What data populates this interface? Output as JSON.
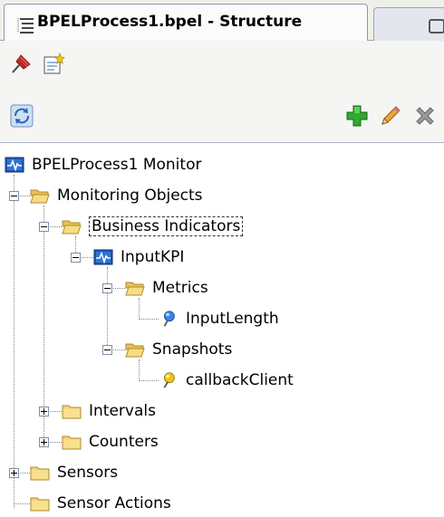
{
  "panel": {
    "tab_title": "BPELProcess1.bpel - Structure"
  },
  "toolbar_top": {
    "pin_icon": "pin-icon",
    "new_icon": "new-document-icon"
  },
  "toolbar_actions": {
    "sync_icon": "synchronize-icon",
    "add_icon": "add-icon",
    "edit_icon": "edit-pencil-icon",
    "delete_icon": "delete-icon"
  },
  "tree": {
    "root": "BPELProcess1 Monitor",
    "monitoring_objects": "Monitoring Objects",
    "business_indicators": "Business Indicators",
    "input_kpi": "InputKPI",
    "metrics": "Metrics",
    "input_length": "InputLength",
    "snapshots": "Snapshots",
    "callback_client": "callbackClient",
    "intervals": "Intervals",
    "counters": "Counters",
    "sensors": "Sensors",
    "sensor_actions": "Sensor Actions"
  },
  "colors": {
    "folder": "#f6d36a",
    "monitor_icon": "#1f57b8",
    "add_green": "#2eaa2e",
    "pin_red": "#d3261f"
  }
}
